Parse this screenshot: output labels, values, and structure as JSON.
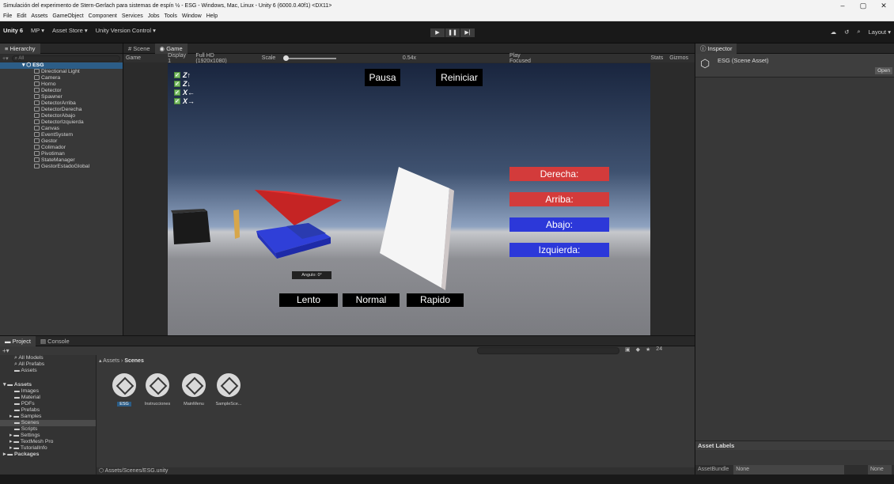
{
  "window": {
    "title": "Simulación del experimento de Stern-Gerlach para sistemas de espín ½ - ESG - Windows, Mac, Linux - Unity 6 (6000.0.40f1) <DX11>",
    "controls": [
      "–",
      "▢",
      "✕"
    ]
  },
  "menu": [
    "File",
    "Edit",
    "Assets",
    "GameObject",
    "Component",
    "Services",
    "Jobs",
    "Tools",
    "Window",
    "Help"
  ],
  "toolbar": {
    "unity": "Unity 6",
    "mp": "MP ▾",
    "asset_store": "Asset Store ▾",
    "version_control": "Unity Version Control ▾",
    "layout": "Layout ▾"
  },
  "hierarchy": {
    "tab": "Hierarchy",
    "search_placeholder": "All",
    "root": "ESG",
    "items": [
      "Directional Light",
      "Camera",
      "Horno",
      "Detector",
      "Spawner",
      "DetectorArriba",
      "DetectorDerecha",
      "DetectorAbajo",
      "DetectorIzquierda",
      "Canvas",
      "EventSystem",
      "Gestor",
      "Colimador",
      "Pivotiman",
      "StateManager",
      "GestorEstadoGlobal"
    ]
  },
  "scene_tabs": [
    "Scene",
    "Game"
  ],
  "game_toolbar": {
    "mode": "Game",
    "display": "Display 1",
    "resolution": "Full HD (1920x1080)",
    "scale_label": "Scale",
    "scale_value": "0.54x",
    "play_focused": "Play Focused",
    "stats": "Stats",
    "gizmos": "Gizmos"
  },
  "game": {
    "pause": "Pausa",
    "restart": "Reiniciar",
    "spins": [
      {
        "label": "Z↑",
        "checked": true
      },
      {
        "label": "Z↓",
        "checked": true
      },
      {
        "label": "X←",
        "checked": true
      },
      {
        "label": "X→",
        "checked": true
      }
    ],
    "detectors": [
      {
        "label": "Derecha:",
        "color": "#d33b3b"
      },
      {
        "label": "Arriba:",
        "color": "#d33b3b"
      },
      {
        "label": "Abajo:",
        "color": "#2c38d9"
      },
      {
        "label": "Izquierda:",
        "color": "#2c38d9"
      }
    ],
    "angle": "Angulo: 0°",
    "speeds": [
      "Lento",
      "Normal",
      "Rapido"
    ]
  },
  "inspector": {
    "tab": "Inspector",
    "title": "ESG (Scene Asset)",
    "open_button": "Open",
    "asset_labels": "Asset Labels",
    "asset_bundle": "AssetBundle",
    "bundle_value": "None",
    "variant_value": "None"
  },
  "project": {
    "tabs": [
      "Project",
      "Console"
    ],
    "favorites": [
      "All Models",
      "All Prefabs",
      "Assets"
    ],
    "tree_root": "Assets",
    "tree": [
      "Images",
      "Material",
      "PDFs",
      "Prefabs",
      "Samples",
      "Scenes",
      "Scripts",
      "Settings",
      "TextMesh Pro",
      "TutorialInfo"
    ],
    "packages": "Packages",
    "breadcrumb_root": "Assets",
    "breadcrumb_current": "Scenes",
    "assets": [
      "ESG",
      "Instrucciones",
      "MainMenu",
      "SampleSce..."
    ],
    "status_path": "Assets/Scenes/ESG.unity",
    "count": "24"
  }
}
